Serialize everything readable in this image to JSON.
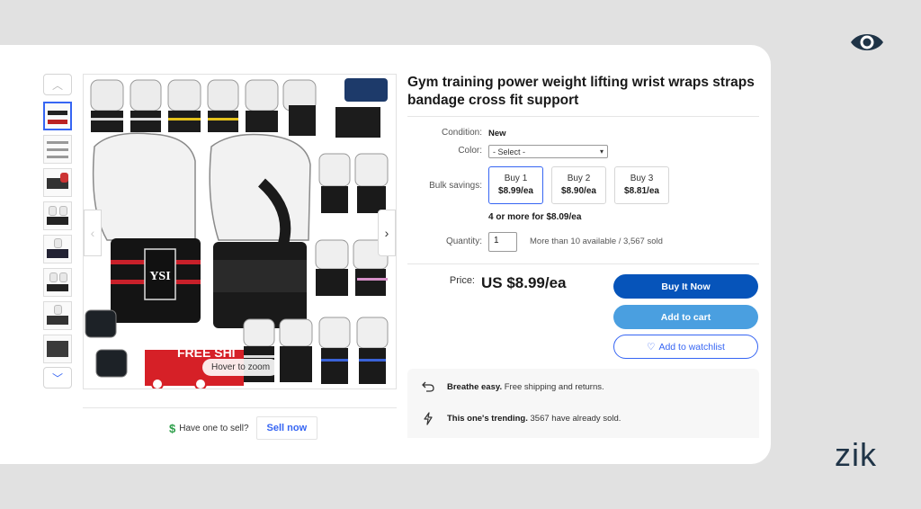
{
  "brand": {
    "name": "zik",
    "eye_icon": "eye-icon",
    "color": "#1f3447"
  },
  "gallery": {
    "thumb_count": 8,
    "image_overlay": {
      "free_ship": "FREE SHI",
      "logo": "YSI"
    },
    "hover_hint": "Hover to zoom",
    "up_icon": "chevron-up-icon",
    "down_icon": "chevron-down-icon"
  },
  "sell": {
    "question": "Have one to sell?",
    "button": "Sell now"
  },
  "product": {
    "title": "Gym training power weight lifting wrist wraps straps bandage cross fit support",
    "condition_label": "Condition:",
    "condition_value": "New",
    "color_label": "Color:",
    "color_select": "- Select -",
    "bulk_label": "Bulk savings:",
    "bulk_options": [
      {
        "qty": "Buy 1",
        "price": "$8.99/ea"
      },
      {
        "qty": "Buy 2",
        "price": "$8.90/ea"
      },
      {
        "qty": "Buy 3",
        "price": "$8.81/ea"
      }
    ],
    "bulk_more": "4 or more for $8.09/ea",
    "quantity_label": "Quantity:",
    "quantity_value": "1",
    "availability": "More than 10 available / 3,567 sold",
    "price_label": "Price:",
    "price": "US $8.99/ea"
  },
  "actions": {
    "buy_now": "Buy It Now",
    "add_to_cart": "Add to cart",
    "watchlist": "Add to watchlist"
  },
  "info": [
    {
      "bold": "Breathe easy.",
      "text": " Free shipping and returns.",
      "icon": "return-arrow-icon"
    },
    {
      "bold": "This one's trending.",
      "text": " 3567 have already sold.",
      "icon": "lightning-icon"
    }
  ],
  "colors": {
    "primary_blue": "#0654ba",
    "cart_blue": "#4a9fe0",
    "link_blue": "#3665f3",
    "background": "#e1e1e1"
  }
}
